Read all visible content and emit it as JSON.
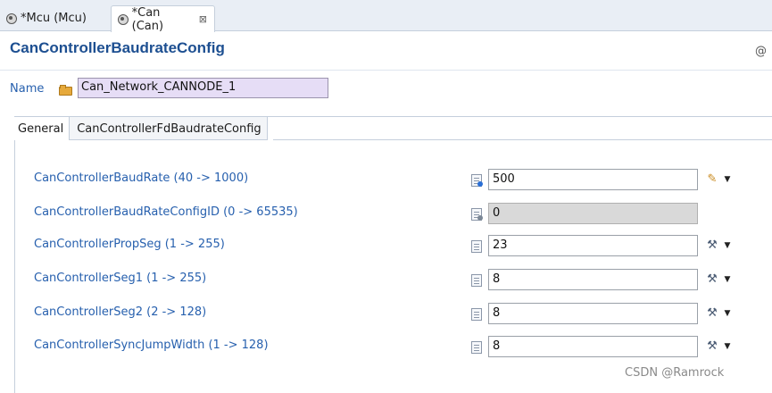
{
  "editor_tabs": [
    {
      "label": "*Mcu (Mcu)"
    },
    {
      "label": "*Can (Can)",
      "close": "⊠"
    }
  ],
  "form": {
    "title": "CanControllerBaudrateConfig",
    "help_icon": "@",
    "name_label": "Name",
    "name_value": "Can_Network_CANNODE_1"
  },
  "folder_tabs": [
    {
      "label": "General"
    },
    {
      "label": "CanControllerFdBaudrateConfig"
    }
  ],
  "params": [
    {
      "label": "CanControllerBaudRate (40 -> 1000)",
      "value": "500",
      "action_icon": "pencil-icon",
      "readonly": false
    },
    {
      "label": "CanControllerBaudRateConfigID (0 -> 65535)",
      "value": "0",
      "action_icon": "none",
      "readonly": true
    },
    {
      "label": "CanControllerPropSeg (1 -> 255)",
      "value": "23",
      "action_icon": "wrench-icon",
      "readonly": false
    },
    {
      "label": "CanControllerSeg1 (1 -> 255)",
      "value": "8",
      "action_icon": "wrench-icon",
      "readonly": false
    },
    {
      "label": "CanControllerSeg2 (2 -> 128)",
      "value": "8",
      "action_icon": "wrench-icon",
      "readonly": false
    },
    {
      "label": "CanControllerSyncJumpWidth (1 -> 128)",
      "value": "8",
      "action_icon": "wrench-icon",
      "readonly": false
    }
  ],
  "watermark": "CSDN @Ramrock",
  "colors": {
    "title": "#1d4f91",
    "label": "#2760ae",
    "name_field_bg": "#e6ddf6",
    "readonly_bg": "#d9d9d9"
  }
}
